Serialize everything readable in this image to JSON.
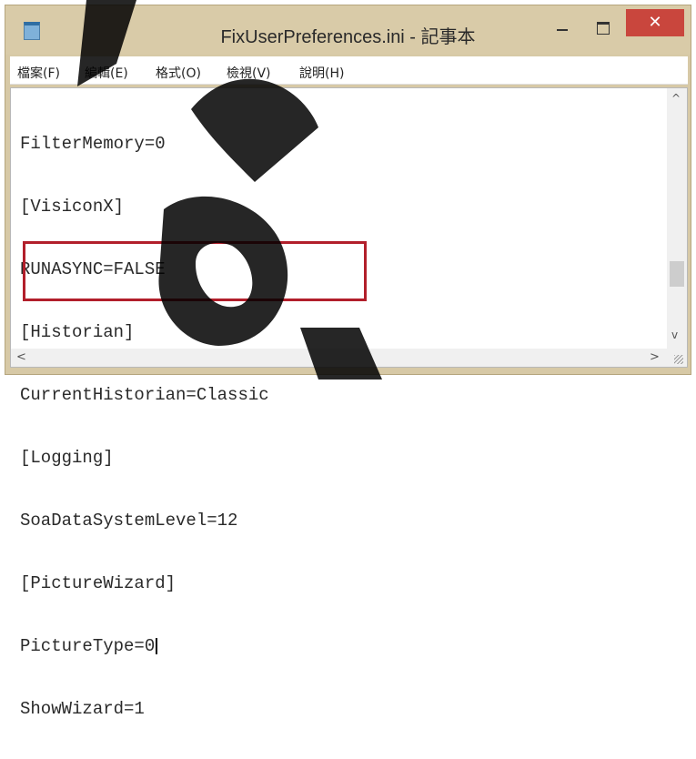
{
  "window": {
    "title": "FixUserPreferences.ini - 記事本",
    "close_label": "✕"
  },
  "menu": {
    "items": [
      "檔案(F)",
      "編輯(E)",
      "格式(O)",
      "檢視(V)",
      "說明(H)"
    ]
  },
  "editor": {
    "lines": [
      "FilterMemory=0",
      "[VisiconX]",
      "RUNASYNC=FALSE",
      "[Historian]",
      "CurrentHistorian=Classic",
      "[Logging]",
      "SoaDataSystemLevel=12",
      "[PictureWizard]",
      "PictureType=0",
      "ShowWizard=1"
    ],
    "highlighted_lines": [
      3,
      4
    ],
    "highlight_color": "#b21f2b"
  },
  "scrollbars": {
    "up_arrow": "^",
    "down_arrow": "v",
    "left_arrow": "<",
    "right_arrow": ">"
  },
  "colors": {
    "titlebar": "#d9cba8",
    "close_button": "#c9463d"
  }
}
